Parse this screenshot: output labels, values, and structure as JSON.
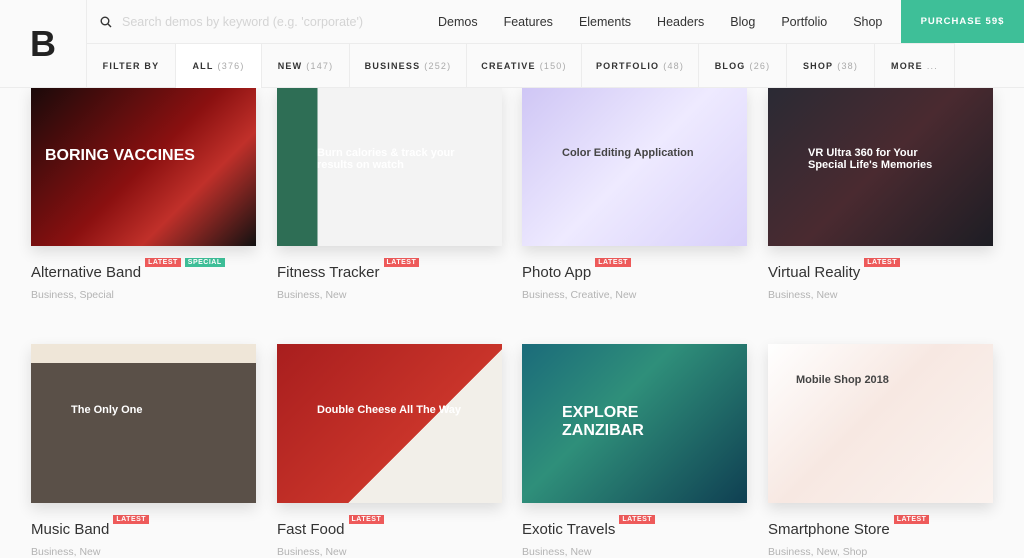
{
  "logo": "B",
  "search": {
    "placeholder": "Search demos by keyword (e.g. 'corporate')"
  },
  "nav": [
    "Demos",
    "Features",
    "Elements",
    "Headers",
    "Blog",
    "Portfolio",
    "Shop"
  ],
  "purchase": "PURCHASE 59$",
  "colors": {
    "accent": "#3ebf98",
    "latest": "#ef5b5b",
    "special": "#3ebf98"
  },
  "filters": [
    {
      "label": "FILTER BY",
      "count": ""
    },
    {
      "label": "ALL",
      "count": "(376)",
      "active": true
    },
    {
      "label": "NEW",
      "count": "(147)"
    },
    {
      "label": "BUSINESS",
      "count": "(252)"
    },
    {
      "label": "CREATIVE",
      "count": "(150)"
    },
    {
      "label": "PORTFOLIO",
      "count": "(48)"
    },
    {
      "label": "BLOG",
      "count": "(26)"
    },
    {
      "label": "SHOP",
      "count": "(38)"
    },
    {
      "label": "MORE",
      "count": "..."
    }
  ],
  "demos": [
    {
      "title": "Alternative Band",
      "badges": [
        "LATEST",
        "SPECIAL"
      ],
      "tags": "Business, Special",
      "thumb_text": "BORING VACCINES",
      "bg": "linear-gradient(135deg,#1a0a0a,#8a1010 50%,#c0302a 70%,#111)"
    },
    {
      "title": "Fitness Tracker",
      "badges": [
        "LATEST"
      ],
      "tags": "Business, New",
      "thumb_text": "Burn calories & track your results on watch",
      "bg": "linear-gradient(90deg,#2e6e55 0 18%,#f3f3f3 18% 100%)"
    },
    {
      "title": "Photo App",
      "badges": [
        "LATEST"
      ],
      "tags": "Business, Creative, New",
      "thumb_text": "Color Editing Application",
      "bg": "linear-gradient(135deg,#cfc6f5,#eeeaff 50%,#d8d0fa)"
    },
    {
      "title": "Virtual Reality",
      "badges": [
        "LATEST"
      ],
      "tags": "Business, New",
      "thumb_text": "VR Ultra 360 for Your Special Life's Memories",
      "bg": "linear-gradient(135deg,#2a2a34,#4a2a30 50%,#1d1d24)"
    },
    {
      "title": "Music Band",
      "badges": [
        "LATEST"
      ],
      "tags": "Business, New",
      "thumb_text": "The Only One",
      "bg": "linear-gradient(180deg,#efe6d8 0 12%,#5a5048 12% 100%)"
    },
    {
      "title": "Fast Food",
      "badges": [
        "LATEST"
      ],
      "tags": "Business, New",
      "thumb_text": "Double Cheese All The Way",
      "bg": "linear-gradient(135deg,#a81e1e,#c9342a 60%,#f2efe9 60%)"
    },
    {
      "title": "Exotic Travels",
      "badges": [
        "LATEST"
      ],
      "tags": "Business, New",
      "thumb_text": "EXPLORE ZANZIBAR",
      "bg": "linear-gradient(135deg,#1b6b7a,#2f8f7a 40%,#0f3f52)"
    },
    {
      "title": "Smartphone Store",
      "badges": [
        "LATEST"
      ],
      "tags": "Business, New, Shop",
      "thumb_text": "Mobile Shop 2018",
      "bg": "linear-gradient(135deg,#ffffff,#f7e8e2 45%,#fbf3ef)"
    }
  ]
}
